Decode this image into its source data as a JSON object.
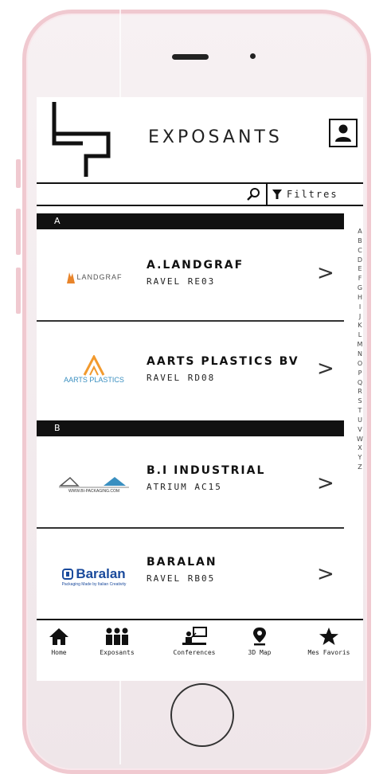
{
  "header": {
    "title": "EXPOSANTS"
  },
  "search": {
    "filter_label": "Filtres"
  },
  "sections": [
    {
      "letter": "A",
      "items": [
        {
          "name": "A.LANDGRAF",
          "location": "RAVEL RE03",
          "logo_text": "LANDGRAF"
        },
        {
          "name": "AARTS PLASTICS BV",
          "location": "RAVEL RD08",
          "logo_text": "AARTS PLASTICS"
        }
      ]
    },
    {
      "letter": "B",
      "items": [
        {
          "name": "B.I INDUSTRIAL",
          "location": "ATRIUM AC15",
          "logo_text": "WWW.BI-PACKAGING.COM"
        },
        {
          "name": "BARALAN",
          "location": "RAVEL RB05",
          "logo_text": "Baralan",
          "logo_sub": "Packaging Made by Italian Creativity"
        }
      ]
    }
  ],
  "alpha_index": [
    "A",
    "B",
    "C",
    "D",
    "E",
    "F",
    "G",
    "H",
    "I",
    "J",
    "K",
    "L",
    "M",
    "N",
    "O",
    "P",
    "Q",
    "R",
    "S",
    "T",
    "U",
    "V",
    "W",
    "X",
    "Y",
    "Z"
  ],
  "tabs": [
    {
      "label": "Home",
      "icon": "home-icon"
    },
    {
      "label": "Exposants",
      "icon": "people-icon"
    },
    {
      "label": "Conferences",
      "icon": "presentation-icon"
    },
    {
      "label": "3D Map",
      "icon": "map-pin-icon"
    },
    {
      "label": "Mes Favoris",
      "icon": "star-icon"
    }
  ],
  "colors": {
    "accent_black": "#111111",
    "phone_frame": "#f0c9d0",
    "aarts_orange": "#f29a2e",
    "landgraf_orange": "#e8842a",
    "baralan_blue": "#1a4a9c"
  }
}
